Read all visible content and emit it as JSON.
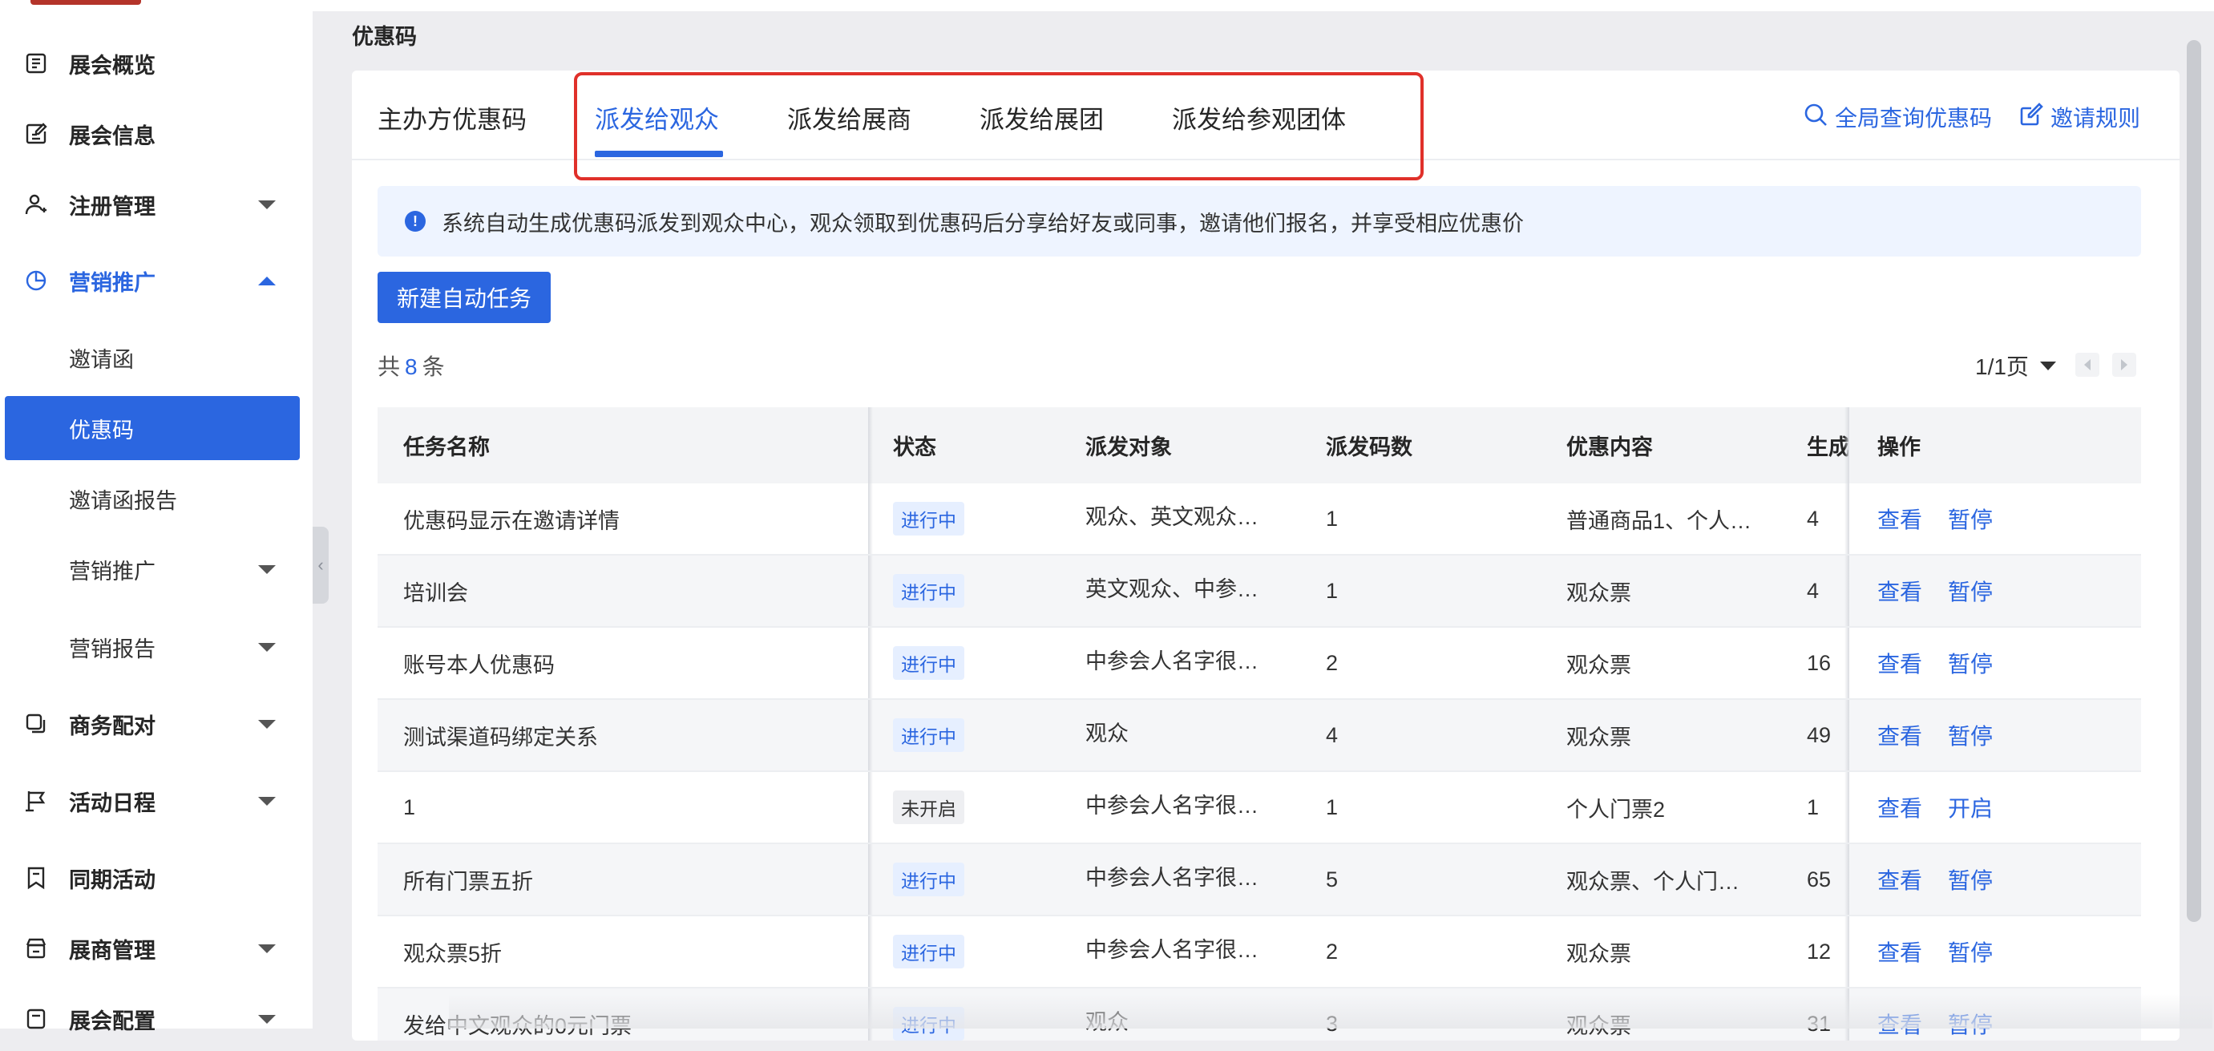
{
  "page_title": "优惠码",
  "sidebar": {
    "items": [
      {
        "label": "展会概览",
        "icon": "list-icon",
        "level": 1
      },
      {
        "label": "展会信息",
        "icon": "edit-doc-icon",
        "level": 1
      },
      {
        "label": "注册管理",
        "icon": "user-add-icon",
        "level": 1,
        "has_caret": true
      },
      {
        "label": "营销推广",
        "icon": "pie-chart-icon",
        "level": 1,
        "has_caret": true,
        "open": true
      },
      {
        "label": "邀请函",
        "level": 2
      },
      {
        "label": "优惠码",
        "level": 2,
        "active": true
      },
      {
        "label": "邀请函报告",
        "level": 2
      },
      {
        "label": "营销推广",
        "level": 2,
        "has_caret": true
      },
      {
        "label": "营销报告",
        "level": 2,
        "has_caret": true
      },
      {
        "label": "商务配对",
        "icon": "copy-icon",
        "level": 1,
        "has_caret": true
      },
      {
        "label": "活动日程",
        "icon": "flag-icon",
        "level": 1,
        "has_caret": true
      },
      {
        "label": "同期活动",
        "icon": "bookmark-icon",
        "level": 1
      },
      {
        "label": "展商管理",
        "icon": "store-icon",
        "level": 1,
        "has_caret": true
      },
      {
        "label": "展会配置",
        "icon": "settings-doc-icon",
        "level": 1,
        "has_caret": true
      }
    ]
  },
  "tabs": [
    {
      "label": "主办方优惠码"
    },
    {
      "label": "派发给观众",
      "active": true
    },
    {
      "label": "派发给展商"
    },
    {
      "label": "派发给展团"
    },
    {
      "label": "派发给参观团体"
    }
  ],
  "tab_actions": {
    "global_search": "全局查询优惠码",
    "rules": "邀请规则"
  },
  "alert_text": "系统自动生成优惠码派发到观众中心，观众领取到优惠码后分享给好友或同事，邀请他们报名，并享受相应优惠价",
  "new_task_button": "新建自动任务",
  "total": {
    "prefix": "共",
    "count": "8",
    "suffix": "条"
  },
  "pager": {
    "label": "1/1页"
  },
  "table": {
    "columns": [
      "任务名称",
      "状态",
      "派发对象",
      "派发码数",
      "优惠内容",
      "生成",
      "操作"
    ],
    "rows": [
      {
        "name": "优惠码显示在邀请详情",
        "status": "进行中",
        "target": "观众、英文观众…",
        "count": "1",
        "content": "普通商品1、个人…",
        "generated": "4",
        "view": "查看",
        "toggle": "暂停"
      },
      {
        "name": "培训会",
        "status": "进行中",
        "target": "英文观众、中参…",
        "count": "1",
        "content": "观众票",
        "generated": "4",
        "view": "查看",
        "toggle": "暂停"
      },
      {
        "name": "账号本人优惠码",
        "status": "进行中",
        "target": "中参会人名字很…",
        "count": "2",
        "content": "观众票",
        "generated": "16",
        "view": "查看",
        "toggle": "暂停"
      },
      {
        "name": "测试渠道码绑定关系",
        "status": "进行中",
        "target": "观众",
        "count": "4",
        "content": "观众票",
        "generated": "49",
        "view": "查看",
        "toggle": "暂停"
      },
      {
        "name": "1",
        "status": "未开启",
        "target": "中参会人名字很…",
        "count": "1",
        "content": "个人门票2",
        "generated": "1",
        "view": "查看",
        "toggle": "开启"
      },
      {
        "name": "所有门票五折",
        "status": "进行中",
        "target": "中参会人名字很…",
        "count": "5",
        "content": "观众票、个人门…",
        "generated": "65",
        "view": "查看",
        "toggle": "暂停"
      },
      {
        "name": "观众票5折",
        "status": "进行中",
        "target": "中参会人名字很…",
        "count": "2",
        "content": "观众票",
        "generated": "12",
        "view": "查看",
        "toggle": "暂停"
      },
      {
        "name": "发给中文观众的0元门票",
        "status": "进行中",
        "target": "观众",
        "count": "3",
        "content": "观众票",
        "generated": "31",
        "view": "查看",
        "toggle": "暂停"
      }
    ]
  },
  "colors": {
    "primary": "#2b66e0",
    "highlight": "#e0302a",
    "alert_bg": "#eef4ff"
  }
}
